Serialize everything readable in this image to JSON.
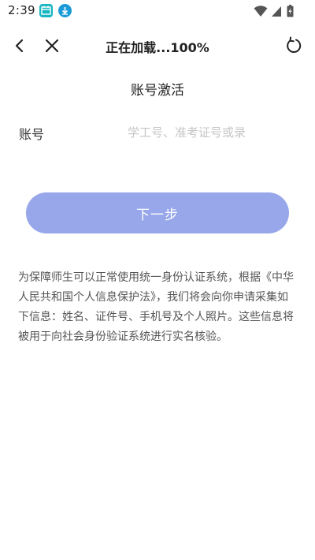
{
  "status_bar": {
    "time": "2:39",
    "icons": [
      "calendar-app-icon",
      "download-app-icon",
      "wifi-icon",
      "signal-icon",
      "battery-icon"
    ]
  },
  "nav": {
    "title": "正在加载...100%",
    "icons": [
      "back-arrow-icon",
      "close-icon",
      "refresh-icon"
    ]
  },
  "page": {
    "title": "账号激活"
  },
  "form": {
    "account_label": "账号",
    "account_placeholder": "学工号、准考证号或录",
    "account_value": ""
  },
  "actions": {
    "next_label": "下一步"
  },
  "notice": {
    "text": "为保障师生可以正常使用统一身份认证系统，根据《中华人民共和国个人信息保护法》，我们将会向你申请采集如下信息：姓名、证件号、手机号及个人照片。这些信息将被用于向社会身份验证系统进行实名核验。"
  },
  "colors": {
    "button_bg": "#97a7ea",
    "button_text": "#ffffff",
    "placeholder": "#c5c5c5",
    "text": "#333333"
  }
}
